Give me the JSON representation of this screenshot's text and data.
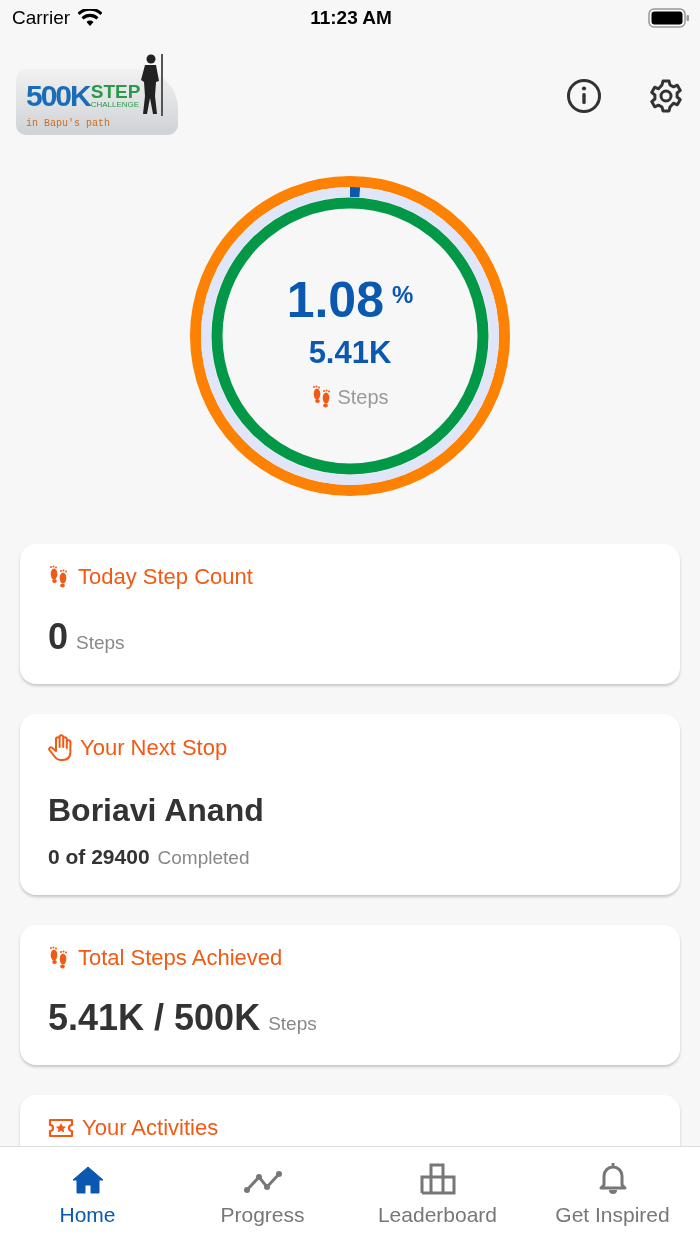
{
  "status_bar": {
    "carrier": "Carrier",
    "time": "11:23 AM"
  },
  "logo": {
    "number": "500K",
    "word": "STEP",
    "sub": "CHALLENGE",
    "tagline": "in Bapu's path"
  },
  "progress_ring": {
    "level": 0.0108,
    "percent": "1.08",
    "percent_sign": "%",
    "steps": "5.41K",
    "label": "Steps"
  },
  "cards": [
    {
      "kind": "count",
      "title": "Today Step Count",
      "value": "0",
      "unit": "Steps"
    },
    {
      "kind": "stop",
      "title": "Your Next Stop",
      "place": "Boriavi Anand",
      "value": "0 of 29400",
      "unit": "Completed"
    },
    {
      "kind": "count",
      "title": "Total Steps Achieved",
      "value": "5.41K / 500K",
      "unit": "Steps"
    },
    {
      "kind": "header",
      "title": "Your Activities"
    }
  ],
  "tabs": [
    {
      "label": "Home",
      "selected": true
    },
    {
      "label": "Progress",
      "selected": false
    },
    {
      "label": "Leaderboard",
      "selected": false
    },
    {
      "label": "Get Inspired",
      "selected": false
    }
  ]
}
